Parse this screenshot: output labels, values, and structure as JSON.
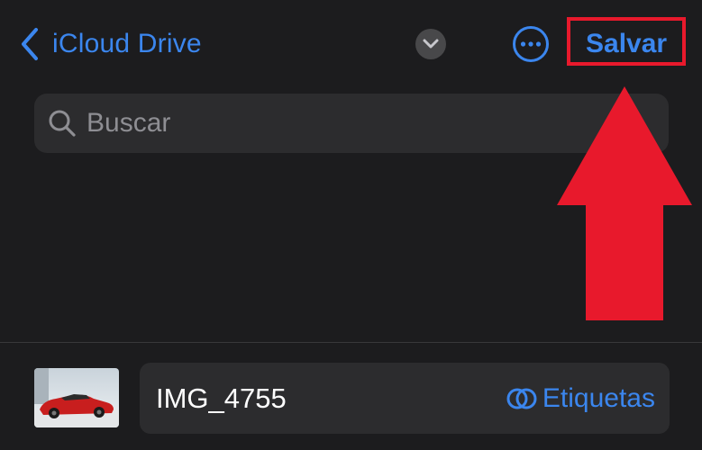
{
  "nav": {
    "back_label": "iCloud Drive",
    "save_label": "Salvar"
  },
  "search": {
    "placeholder": "Buscar"
  },
  "file": {
    "name": "IMG_4755",
    "tags_label": "Etiquetas"
  },
  "colors": {
    "accent": "#3b86ee",
    "background": "#1c1c1e",
    "field": "#2c2c2e",
    "annotation": "#e8192c"
  },
  "icons": [
    "chevron-left-icon",
    "chevron-down-icon",
    "ellipsis-circle-icon",
    "search-icon",
    "tags-icon"
  ]
}
